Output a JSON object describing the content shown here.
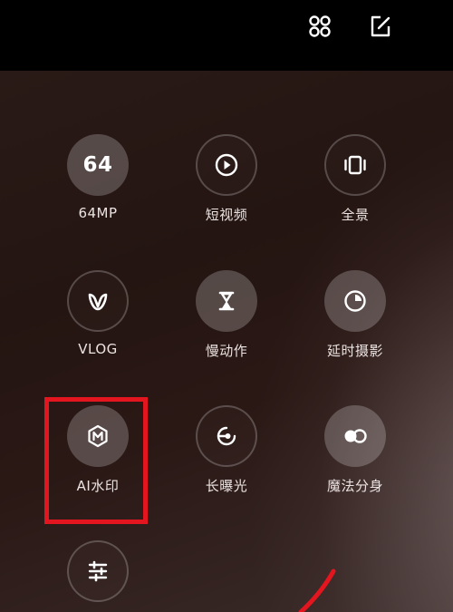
{
  "topbar": {
    "grid_icon": "grid-icon",
    "edit_icon": "edit-icon"
  },
  "modes": [
    {
      "key": "64mp",
      "label": "64MP",
      "badge": "64",
      "icon": "64mp-icon"
    },
    {
      "key": "short_video",
      "label": "短视频",
      "icon": "play-icon"
    },
    {
      "key": "panorama",
      "label": "全景",
      "icon": "panorama-icon"
    },
    {
      "key": "vlog",
      "label": "VLOG",
      "icon": "vlog-icon"
    },
    {
      "key": "slow_motion",
      "label": "慢动作",
      "icon": "hourglass-icon"
    },
    {
      "key": "timelapse",
      "label": "延时摄影",
      "icon": "timer-icon"
    },
    {
      "key": "ai_watermark",
      "label": "AI水印",
      "icon": "watermark-icon"
    },
    {
      "key": "long_exposure",
      "label": "长曝光",
      "icon": "long-exposure-icon"
    },
    {
      "key": "magic_clone",
      "label": "魔法分身",
      "icon": "clone-icon"
    },
    {
      "key": "more",
      "label": "",
      "icon": "sliders-icon"
    }
  ],
  "colors": {
    "highlight": "#e3161f",
    "annotation_stroke": "#e3161f"
  }
}
